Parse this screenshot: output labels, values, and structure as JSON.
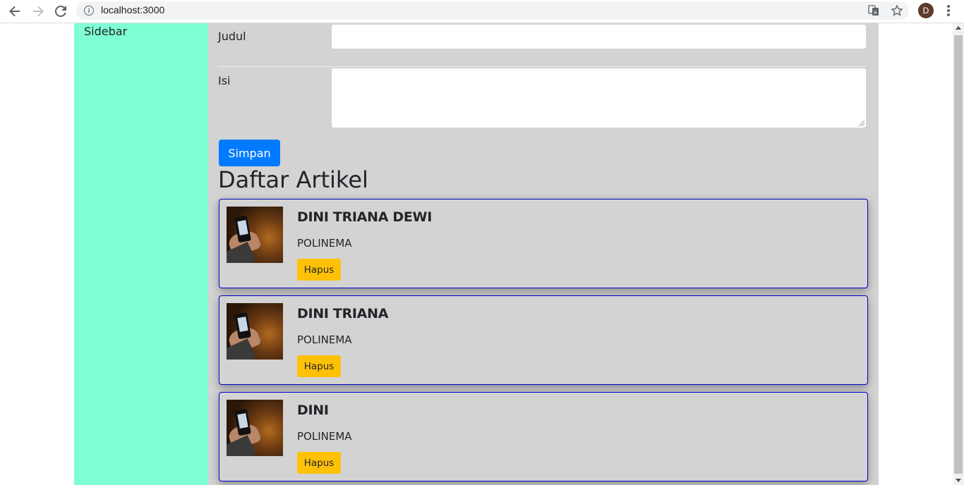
{
  "browser": {
    "url": "localhost:3000",
    "avatar_initial": "D",
    "icons": [
      "back-arrow-icon",
      "forward-arrow-icon",
      "reload-icon",
      "info-icon",
      "translate-icon",
      "star-icon",
      "more-vert-icon"
    ]
  },
  "sidebar": {
    "label": "Sidebar",
    "color": "#7fffd4"
  },
  "form": {
    "judul_label": "Judul",
    "judul_value": "",
    "isi_label": "Isi",
    "isi_value": "",
    "submit_label": "Simpan"
  },
  "articles": {
    "heading": "Daftar Artikel",
    "items": [
      {
        "title": "DINI TRIANA DEWI",
        "subtitle": "POLINEMA",
        "delete_label": "Hapus"
      },
      {
        "title": "DINI TRIANA",
        "subtitle": "POLINEMA",
        "delete_label": "Hapus"
      },
      {
        "title": "DINI",
        "subtitle": "POLINEMA",
        "delete_label": "Hapus"
      }
    ]
  },
  "colors": {
    "main_bg": "#d3d3d3",
    "primary_button": "#007bff",
    "warning_button": "#ffc107",
    "card_border": "#0000cd"
  }
}
